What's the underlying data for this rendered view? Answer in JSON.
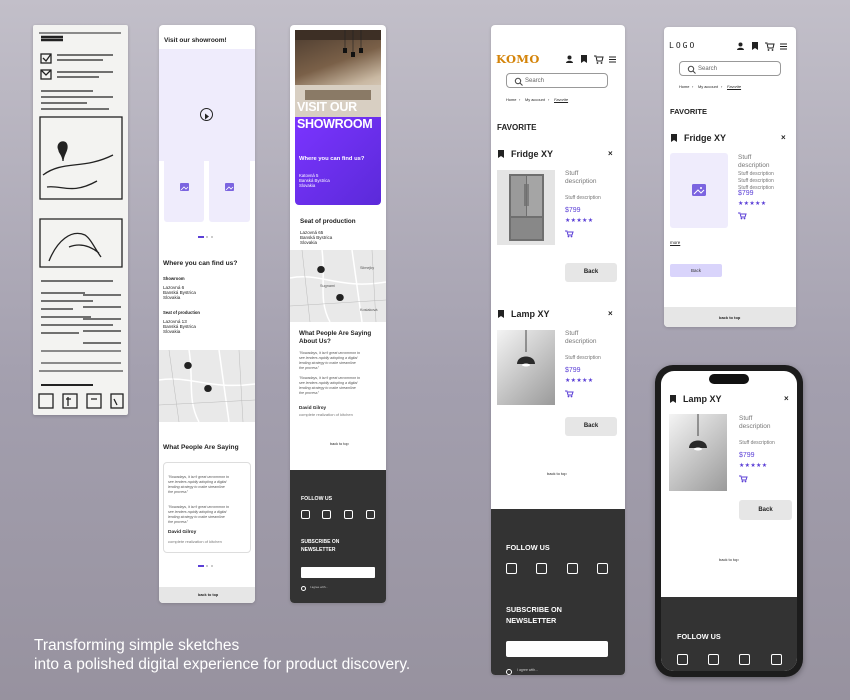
{
  "caption": {
    "line1": "Transforming simple sketches",
    "line2": "into a polished digital experience for product discovery."
  },
  "wireframe2": {
    "title": "Visit our showroom!",
    "find_heading": "Where you can find us?",
    "showroom_label": "Showroom",
    "showroom_addr": [
      "Lazovná 6",
      "Banská Bystrica",
      "Slovakia"
    ],
    "production_label": "Seat of production",
    "production_addr": [
      "Lazovná 13",
      "Banská Bystrica",
      "Slovakia"
    ],
    "people_heading": "What People Are Saying",
    "quote1": [
      "\"Nowadays, it isn't great uncommon to",
      "see lenders rapidly adopting a digital",
      "lending strategy to make streamline",
      "the process\""
    ],
    "quote2": [
      "\"Nowadays, it isn't great uncommon to",
      "see lenders rapidly adopting a digital",
      "lending strategy to make streamline",
      "the process\""
    ],
    "author": "David Gilroy",
    "role": "complete realization of kitchen",
    "back_to_top": "back to top"
  },
  "showroom": {
    "hero_title_1": "VISIT OUR",
    "hero_title_2": "SHOWROOM",
    "find_heading": "Where you can find us?",
    "addr": [
      "Katovná 5",
      "Banská Bystrica",
      "Slovakia"
    ],
    "production_heading": "Seat of production",
    "production_addr": [
      "Lazovná 65",
      "Banská Bystrica",
      "Slovakia"
    ],
    "map_labels": [
      "Slimejky",
      "Sugnami",
      "Kosiaková"
    ],
    "people_heading_1": "What People Are Saying",
    "people_heading_2": "About Us?",
    "quote1": [
      "\"Nowadays, it isn't great uncommon to",
      "see lenders rapidly adopting a digital",
      "lending strategy to make streamline",
      "the process\""
    ],
    "quote2": [
      "\"Nowadays, it isn't great uncommon to",
      "see lenders rapidly adopting a digital",
      "lending strategy to make streamline",
      "the process\""
    ],
    "author": "David Gilroy",
    "role": "complete realization of kitchen",
    "back_to_top": "back to top",
    "follow_us": "FOLLOW US",
    "newsletter_1": "SUBSCRIBE ON",
    "newsletter_2": "NEWSLETTER",
    "agree": "I agree with..."
  },
  "komo": {
    "logo": "KOMO",
    "search_placeholder": "Search",
    "crumbs": [
      "Home",
      "My account",
      "Favorite"
    ],
    "section": "FAVORITE",
    "items": [
      {
        "name": "Fridge XY",
        "desc1": "Stuff",
        "desc2": "description",
        "desc3": "Stuff description",
        "price": "$799",
        "stars": "★★★★★",
        "back": "Back"
      },
      {
        "name": "Lamp XY",
        "desc1": "Stuff",
        "desc2": "description",
        "desc3": "Stuff description",
        "price": "$799",
        "stars": "★★★★★",
        "back": "Back"
      }
    ],
    "back_to_top": "back to top",
    "follow_us": "FOLLOW US",
    "newsletter_1": "SUBSCRIBE ON",
    "newsletter_2": "NEWSLETTER",
    "agree": "I agree with..."
  },
  "logo_screen": {
    "logo": "LOGO",
    "search_placeholder": "Search",
    "crumbs": [
      "Home",
      "My account",
      "Favorite"
    ],
    "section": "FAVORITE",
    "item_name": "Fridge XY",
    "desc": [
      "Stuff",
      "description",
      "Stuff description",
      "Stuff description",
      "Stuff description"
    ],
    "price": "$799",
    "stars": "★★★★★",
    "more": "more",
    "back": "Back",
    "back_to_top": "back to top"
  },
  "phone": {
    "item_name": "Lamp XY",
    "desc1": "Stuff",
    "desc2": "description",
    "desc3": "Stuff description",
    "price": "$799",
    "stars": "★★★★★",
    "back": "Back",
    "back_to_top": "back to top",
    "follow_us": "FOLLOW US"
  },
  "colors": {
    "accent": "#5b3fd6",
    "logo_orange": "#d4840a",
    "footer": "#333333"
  }
}
